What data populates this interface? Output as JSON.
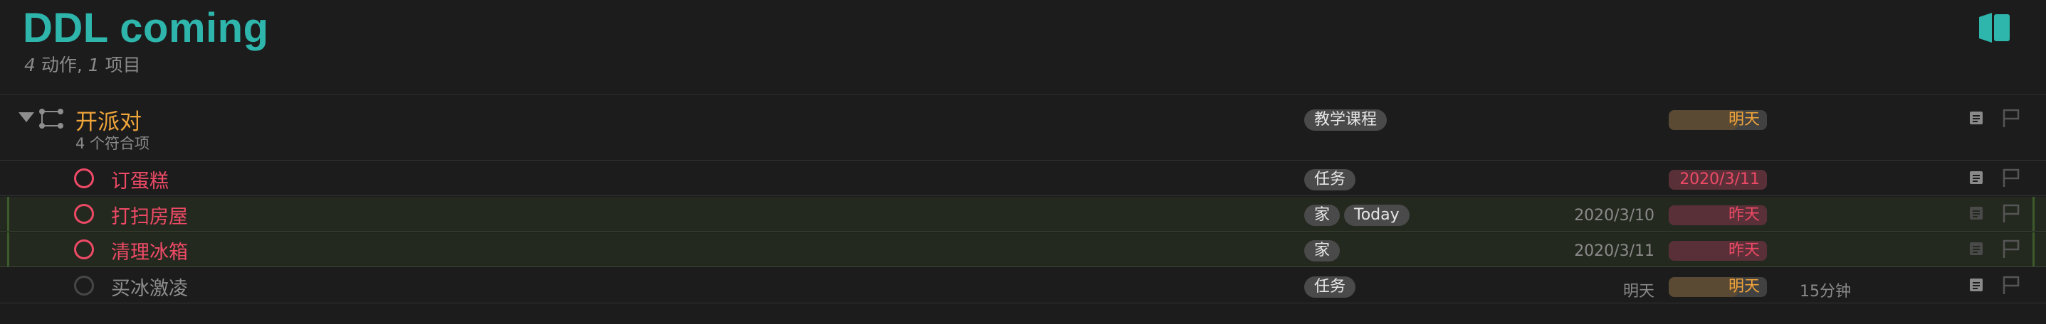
{
  "header": {
    "title": "DDL coming",
    "actions_count": "4",
    "actions_label": " 动作, ",
    "projects_count": "1",
    "projects_label": " 项目"
  },
  "project": {
    "title": "开派对",
    "subtitle": "4 个符合项",
    "tag": "教学课程",
    "due": "明天"
  },
  "tasks": [
    {
      "title": "订蛋糕",
      "tags": [
        "任务"
      ],
      "defer": "",
      "due": "2020/3/11",
      "duration": ""
    },
    {
      "title": "打扫房屋",
      "tags": [
        "家",
        "Today"
      ],
      "defer": "2020/3/10",
      "due": "昨天",
      "duration": ""
    },
    {
      "title": "清理冰箱",
      "tags": [
        "家"
      ],
      "defer": "2020/3/11",
      "due": "昨天",
      "duration": ""
    },
    {
      "title": "买冰激凌",
      "tags": [
        "任务"
      ],
      "defer": "明天",
      "due": "明天",
      "duration": "15分钟"
    }
  ],
  "colors": {
    "accent": "#2eb6ac",
    "project": "#f0a53a",
    "overdue": "#ee4a66",
    "background": "#1c1c1d"
  },
  "icons": {
    "view": "sidebar-panel-icon",
    "project": "project-outline-icon",
    "note": "note-icon",
    "flag": "flag-icon"
  }
}
